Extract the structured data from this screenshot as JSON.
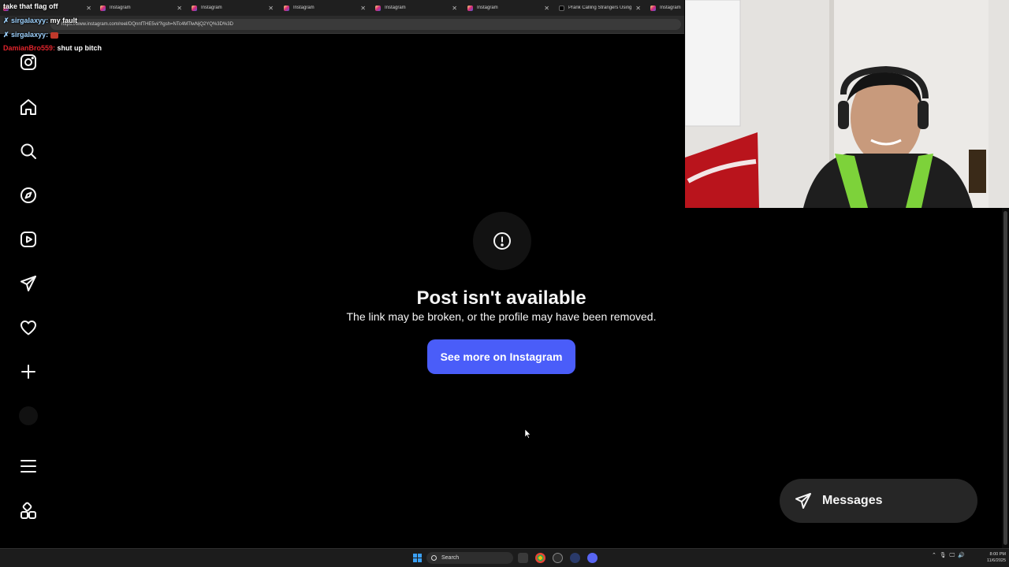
{
  "browser": {
    "tabs": [
      {
        "title": "",
        "type": "instagram"
      },
      {
        "title": "Instagram",
        "type": "instagram"
      },
      {
        "title": "Instagram",
        "type": "instagram"
      },
      {
        "title": "Instagram",
        "type": "instagram"
      },
      {
        "title": "Instagram",
        "type": "instagram"
      },
      {
        "title": "Instagram",
        "type": "instagram"
      },
      {
        "title": "Prank Calling Strangers Using",
        "type": "tiktok"
      },
      {
        "title": "Instagram",
        "type": "instagram"
      }
    ],
    "address": "https://www.instagram.com/reel/DQnnfTHE5vi/?igsh=NTc4MTlwNjQ2YQ%3D%3D"
  },
  "chat": [
    {
      "user": "",
      "message": "take that flag off"
    },
    {
      "user": "sirgalaxyy",
      "message": "my fault"
    },
    {
      "user": "sirgalaxyy",
      "message": ""
    },
    {
      "user": "DamianBro559",
      "message": "shut up bitch"
    }
  ],
  "sidebar": {
    "icons": [
      "instagram-logo-icon",
      "home-icon",
      "search-icon",
      "explore-icon",
      "reels-icon",
      "messages-icon",
      "notifications-icon",
      "create-icon",
      "profile-avatar",
      "menu-icon",
      "more-apps-icon"
    ]
  },
  "main": {
    "title": "Post isn't available",
    "subtitle": "The link may be broken, or the profile may have been removed.",
    "cta": "See more on Instagram"
  },
  "messages": {
    "label": "Messages"
  },
  "taskbar": {
    "search": "Search",
    "time": "8:00 PM",
    "date": "11/6/2025"
  },
  "colors": {
    "accent": "#4a5df9",
    "background": "#000000",
    "pill": "#262626"
  }
}
